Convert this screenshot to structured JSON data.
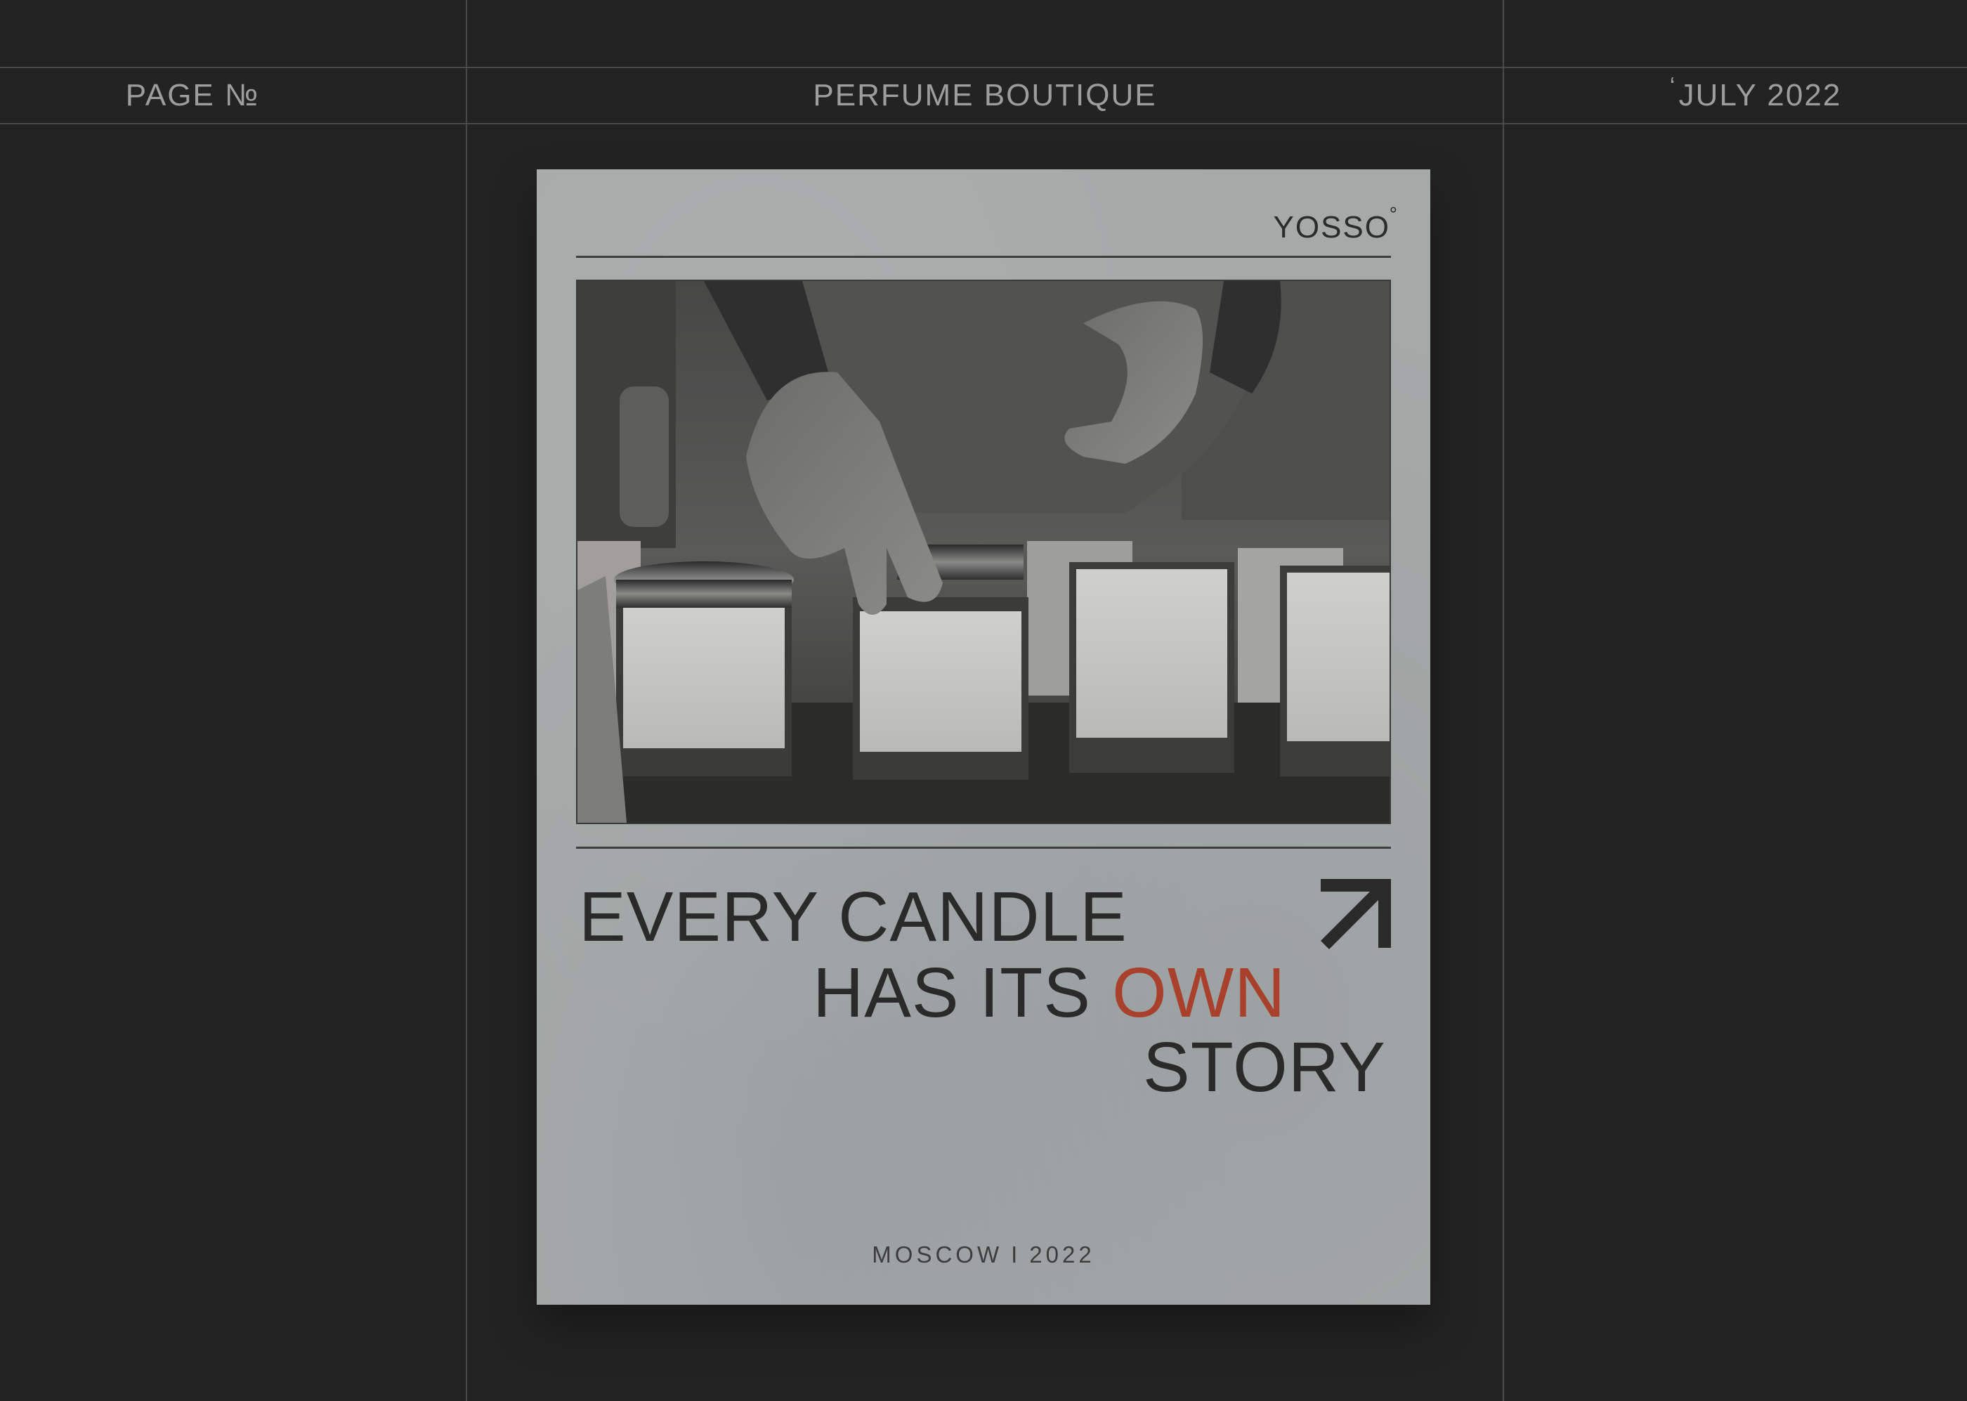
{
  "header": {
    "left_label": "PAGE №",
    "center_label": "PERFUME BOUTIQUE",
    "right_tick": "ʻ",
    "right_label": "JULY 2022"
  },
  "poster": {
    "brand": "YOSSO",
    "brand_mark": "°",
    "headline_line1": "EVERY CANDLE",
    "headline_line2_prefix": "HAS ITS",
    "headline_line2_accent": "OWN",
    "headline_line3": "STORY",
    "footer_city": "MOSCOW",
    "footer_separator": "I",
    "footer_year": "2022",
    "photo_subject": "hands placing lids on glass candle jars",
    "arrow_icon": "arrow-up-right-icon",
    "colors": {
      "background": "#232323",
      "poster": "#a5a9a8",
      "text": "#2a2a2a",
      "accent": "#a9402c",
      "header_text": "#9d9d9d"
    }
  }
}
